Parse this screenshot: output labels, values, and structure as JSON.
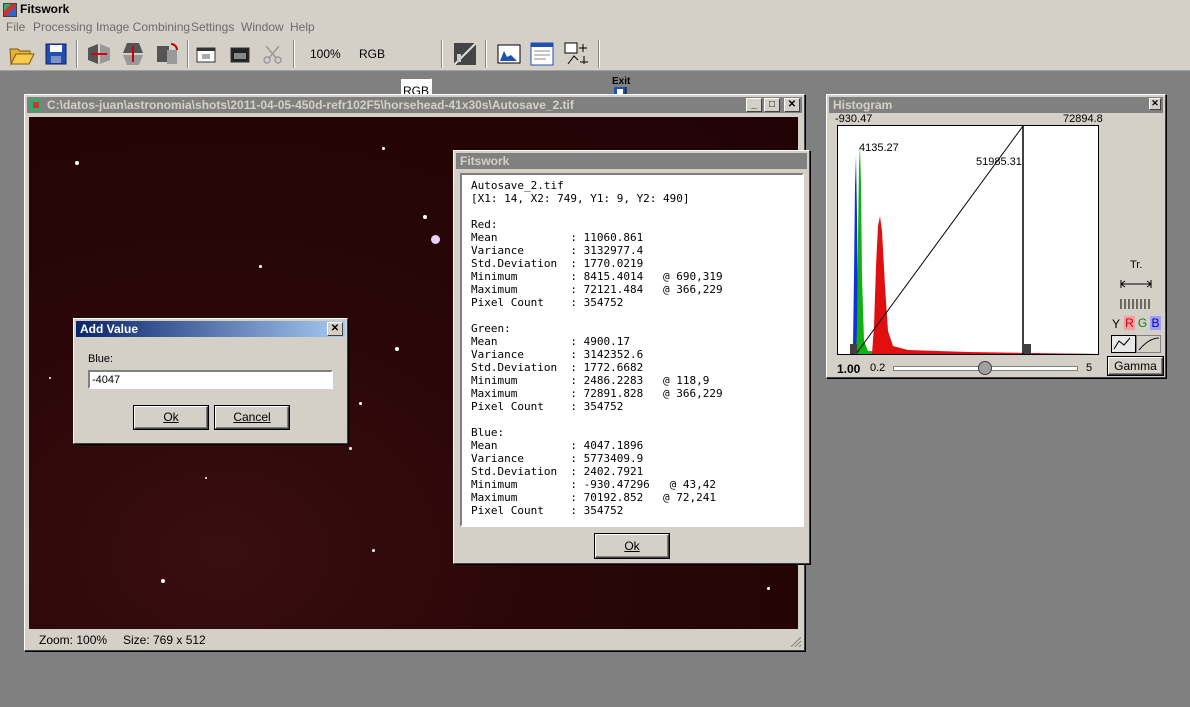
{
  "app": {
    "title": "Fitswork"
  },
  "menu": [
    "File",
    "Processing",
    "Image Combining",
    "Settings",
    "Window",
    "Help"
  ],
  "toolbar": {
    "zoom": "100%",
    "rgb1": "RGB",
    "rgb2": "RGB",
    "exit": "Exit"
  },
  "image_window": {
    "title": "C:\\datos-juan\\astronomia\\shots\\2011-04-05-450d-refr102F5\\horsehead-41x30s\\Autosave_2.tif",
    "zoom": "Zoom: 100%",
    "size": "Size: 769 x 512"
  },
  "stats_window": {
    "title": "Fitswork",
    "lines": [
      "Autosave_2.tif",
      "[X1: 14, X2: 749, Y1: 9, Y2: 490]",
      "",
      "Red:",
      "Mean           : 11060.861",
      "Variance       : 3132977.4",
      "Std.Deviation  : 1770.0219",
      "Minimum        : 8415.4014   @ 690,319",
      "Maximum        : 72121.484   @ 366,229",
      "Pixel Count    : 354752",
      "",
      "Green:",
      "Mean           : 4900.17",
      "Variance       : 3142352.6",
      "Std.Deviation  : 1772.6682",
      "Minimum        : 2486.2283   @ 118,9",
      "Maximum        : 72891.828   @ 366,229",
      "Pixel Count    : 354752",
      "",
      "Blue:",
      "Mean           : 4047.1896",
      "Variance       : 5773409.9",
      "Std.Deviation  : 2402.7921",
      "Minimum        : -930.47296   @ 43,42",
      "Maximum        : 70192.852   @ 72,241",
      "Pixel Count    : 354752"
    ],
    "ok": "Ok"
  },
  "add_value_dialog": {
    "title": "Add Value",
    "label": "Blue:",
    "value": "-4047",
    "ok": "Ok",
    "cancel": "Cancel"
  },
  "histogram": {
    "title": "Histogram",
    "min_label": "-930.47",
    "max_label": "72894.8",
    "black_point_label": "4135.27",
    "white_point_label": "51985.31",
    "gamma_value": "1.00",
    "slider_min": "0.2",
    "slider_max": "5",
    "tr_label": "Tr.",
    "channel_y": "Y",
    "channel_r": "R",
    "channel_g": "G",
    "channel_b": "B",
    "gamma_button": "Gamma",
    "colors": {
      "red": "#e01010",
      "green": "#10b010",
      "blue": "#1030e0"
    }
  }
}
